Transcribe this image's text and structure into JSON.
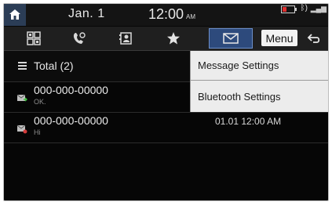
{
  "status_bar": {
    "date": "Jan. 1",
    "time": "12:00",
    "ampm": "AM",
    "icons": [
      "battery-icon",
      "bluetooth-icon",
      "signal-icon"
    ]
  },
  "tabs": [
    {
      "name": "dial-pad-tab",
      "icon": "keypad-icon",
      "active": false
    },
    {
      "name": "call-history-tab",
      "icon": "phone-icon",
      "active": false
    },
    {
      "name": "contacts-tab",
      "icon": "contacts-icon",
      "active": false
    },
    {
      "name": "favorites-tab",
      "icon": "star-icon",
      "active": false
    },
    {
      "name": "messages-tab",
      "icon": "envelope-icon",
      "active": true
    }
  ],
  "toolbar": {
    "menu_label": "Menu"
  },
  "list": {
    "total_label": "Total (2)",
    "items": [
      {
        "number": "000-000-00000",
        "preview": "OK.",
        "time": "",
        "icon": "sent-message-icon"
      },
      {
        "number": "000-000-00000",
        "preview": "Hi",
        "time": "01.01 12:00 AM",
        "icon": "received-message-icon"
      }
    ]
  },
  "menu": {
    "items": [
      {
        "label": "Message Settings"
      },
      {
        "label": "Bluetooth Settings"
      }
    ]
  },
  "colors": {
    "active_tab": "#2d4a7c",
    "home_button": "#2b3d56",
    "battery_level": "#e03030",
    "menu_background": "#ececec"
  }
}
